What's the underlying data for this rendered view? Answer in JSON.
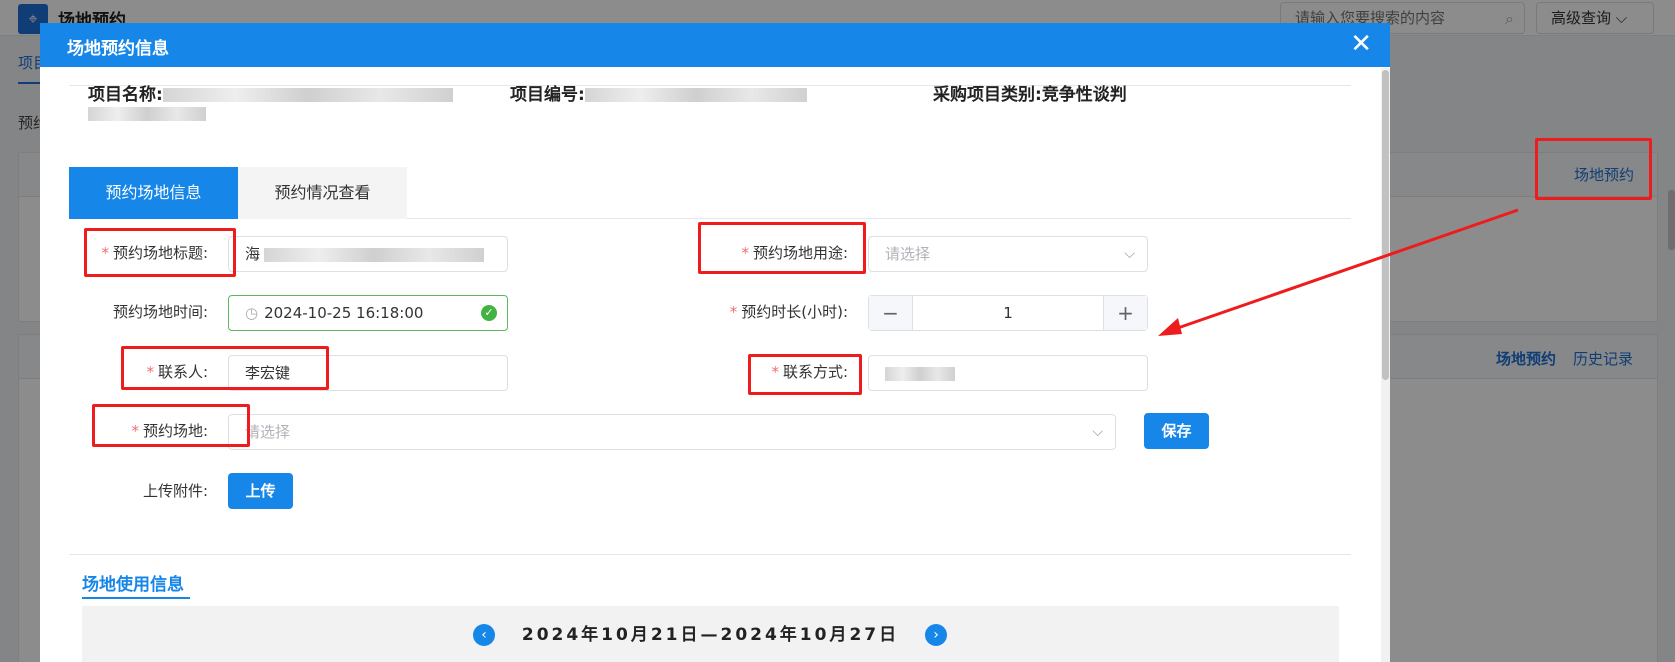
{
  "background": {
    "logo_icon": "map-icon",
    "title": "场地预约",
    "search_placeholder": "请输入您要搜索的内容",
    "advanced_label": "高级查询",
    "tab_label": "项目",
    "section_label": "预约",
    "panel1_link": "场地预约",
    "panel2_link1": "场地预约",
    "panel2_link2": "历史记录"
  },
  "dialog": {
    "title": "场地预约信息",
    "close_icon": "close-icon",
    "project": {
      "name_label": "项目名称:",
      "number_label": "项目编号:",
      "category_label": "采购项目类别:",
      "category_value": "竞争性谈判"
    },
    "tabs": [
      {
        "label": "预约场地信息",
        "active": true
      },
      {
        "label": "预约情况查看",
        "active": false
      }
    ],
    "form": {
      "venue_title_label": "预约场地标题:",
      "venue_title_prefix": "海",
      "venue_use_label": "预约场地用途:",
      "venue_use_placeholder": "请选择",
      "venue_time_label": "预约场地时间:",
      "venue_time_value": "2024-10-25 16:18:00",
      "duration_label": "预约时长(小时):",
      "duration_value": "1",
      "contact_label": "联系人:",
      "contact_value": "李宏键",
      "phone_label": "联系方式:",
      "venue_label": "预约场地:",
      "venue_placeholder": "请选择",
      "save_label": "保存",
      "attach_label": "上传附件:",
      "upload_label": "上传"
    },
    "usage": {
      "title": "场地使用信息",
      "week_range": "2024年10月21日—2024年10月27日"
    }
  },
  "colors": {
    "primary": "#1686e8",
    "highlight": "#ee1c1c",
    "required": "#f56c6c",
    "success": "#43b244"
  }
}
